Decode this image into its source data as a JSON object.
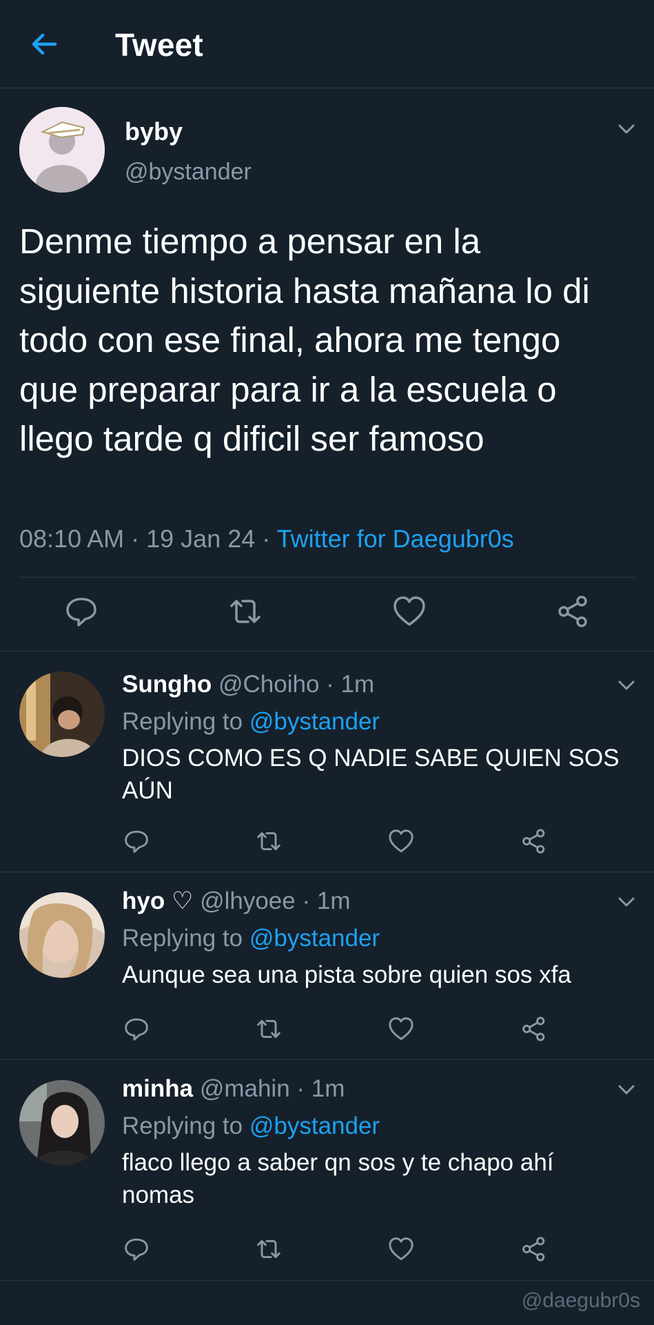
{
  "header": {
    "title": "Tweet",
    "back_icon": "arrow-left-icon",
    "accent": "#1da1f2"
  },
  "main_tweet": {
    "name": "byby",
    "handle": "@bystander",
    "text": "Denme tiempo a pensar en la siguiente historia hasta mañana lo di todo con ese final, ahora me tengo que preparar para ir a la escuela o llego tarde q dificil ser famoso",
    "time": "08:10 AM",
    "date": "19 Jan 24",
    "source": "Twitter for Daegubr0s",
    "dot": "·",
    "actions": [
      "reply-icon",
      "retweet-icon",
      "like-icon",
      "share-icon"
    ]
  },
  "replies": [
    {
      "name": "Sungho",
      "handle": "@Choiho",
      "time": "· 1m",
      "replying_label": "Replying to",
      "replying_to": "@bystander",
      "text": "DIOS COMO ES Q NADIE SABE QUIEN SOS AÚN"
    },
    {
      "name": "hyo ♡",
      "handle": "@lhyoee",
      "time": "· 1m",
      "replying_label": "Replying to",
      "replying_to": "@bystander",
      "text": "Aunque sea una pista sobre quien sos xfa"
    },
    {
      "name": "minha",
      "handle": "@mahin",
      "time": "· 1m",
      "replying_label": "Replying to",
      "replying_to": "@bystander",
      "text": "flaco llego a saber qn sos y te chapo ahí nomas"
    }
  ],
  "watermark": "@daegubr0s",
  "colors": {
    "background": "#15202b",
    "muted": "#8899a6",
    "link": "#1da1f2",
    "divider": "#2a3744"
  }
}
